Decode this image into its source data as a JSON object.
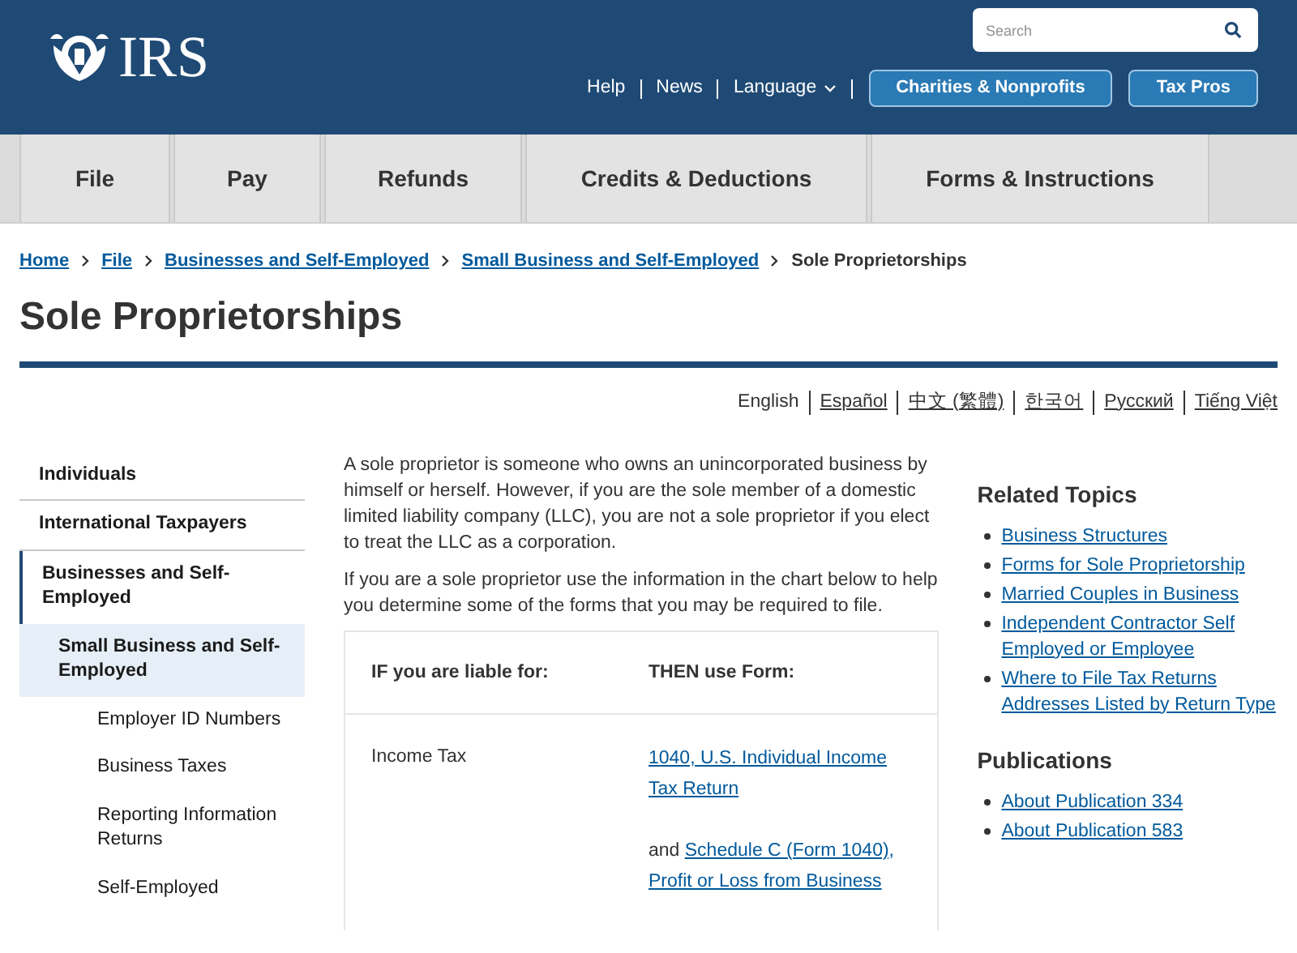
{
  "header": {
    "logo_text": "IRS",
    "search": {
      "placeholder": "Search"
    },
    "links": [
      {
        "label": "Help",
        "kind": "link"
      },
      {
        "label": "News",
        "kind": "link"
      },
      {
        "label": "Language",
        "kind": "dropdown"
      }
    ],
    "buttons": [
      "Charities & Nonprofits",
      "Tax Pros"
    ]
  },
  "nav": {
    "tabs": [
      {
        "label": "File"
      },
      {
        "label": "Pay"
      },
      {
        "label": "Refunds"
      },
      {
        "label": "Credits & Deductions"
      },
      {
        "label": "Forms & Instructions"
      }
    ]
  },
  "breadcrumb": {
    "links": [
      "Home",
      "File",
      "Businesses and Self-Employed",
      "Small Business and Self-Employed"
    ],
    "current": "Sole Proprietorships"
  },
  "title": "Sole Proprietorships",
  "languages": [
    {
      "label": "English",
      "selected": true
    },
    {
      "label": "Español",
      "selected": false
    },
    {
      "label": "中文 (繁體)",
      "selected": false
    },
    {
      "label": "한국어",
      "selected": false
    },
    {
      "label": "Русский",
      "selected": false
    },
    {
      "label": "Tiếng Việt",
      "selected": false
    }
  ],
  "sidebar": {
    "items": [
      {
        "label": "Individuals",
        "selected": false
      },
      {
        "label": "International Taxpayers",
        "selected": false
      },
      {
        "label": "Businesses and Self-Employed",
        "selected": false,
        "children": [
          {
            "label": "Small Business and Self-Employed",
            "selected": true,
            "children": [
              {
                "label": "Employer ID Numbers",
                "selected": false
              },
              {
                "label": "Business Taxes",
                "selected": false
              },
              {
                "label": "Reporting Information Returns",
                "selected": false
              },
              {
                "label": "Self-Employed",
                "selected": false
              }
            ]
          }
        ]
      }
    ]
  },
  "intro": [
    "A sole proprietor is someone who owns an unincorporated business by himself or herself. However, if you are the sole member of a domestic limited liability company (LLC), you are not a sole proprietor if you elect to treat the LLC as a corporation.",
    "If you are a sole proprietor use the information in the chart below to help you determine some of the forms that you may be required to file."
  ],
  "table": {
    "columns": [
      "IF you are liable for:",
      "THEN use Form:"
    ],
    "rows": [
      {
        "liability": "Income Tax",
        "forms": [
          {
            "link": "1040, U.S. Individual Income Tax Return"
          },
          {
            "prefix": "and",
            "link": "Schedule C (Form 1040), Profit or Loss from Business"
          }
        ]
      }
    ]
  },
  "related": {
    "title": "Related Topics",
    "links": [
      "Business Structures",
      "Forms for Sole Proprietorship",
      "Married Couples in Business",
      "Independent Contractor Self Employed or Employee",
      "Where to File Tax Returns Addresses Listed by Return Type"
    ]
  },
  "publications": {
    "title": "Publications",
    "links": [
      "About Publication 334",
      "About Publication 583"
    ]
  }
}
